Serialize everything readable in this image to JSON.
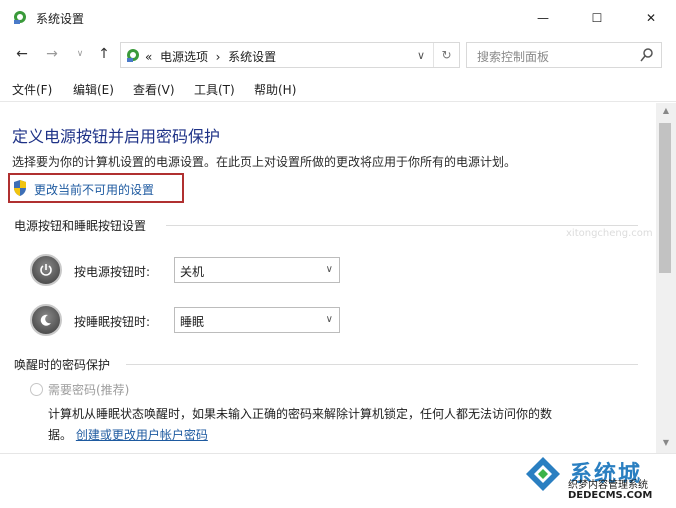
{
  "window": {
    "title": "系统设置",
    "controls": {
      "minimize": "—",
      "maximize": "☐",
      "close": "✕"
    }
  },
  "nav": {
    "back": "←",
    "forward": "→",
    "dropdown": "∨",
    "up": "↑",
    "breadcrumb_chevron": "«",
    "crumbs": [
      "电源选项",
      "系统设置"
    ],
    "crumb_sep": "›",
    "address_dropdown": "∨",
    "refresh": "↻"
  },
  "search": {
    "placeholder": "搜索控制面板"
  },
  "menu": [
    "文件(F)",
    "编辑(E)",
    "查看(V)",
    "工具(T)",
    "帮助(H)"
  ],
  "main": {
    "heading": "定义电源按钮并启用密码保护",
    "description": "选择要为你的计算机设置的电源设置。在此页上对设置所做的更改将应用于你所有的电源计划。",
    "change_link": "更改当前不可用的设置",
    "section_buttons": "电源按钮和睡眠按钮设置",
    "power_button": {
      "label": "按电源按钮时:",
      "value": "关机"
    },
    "sleep_button": {
      "label": "按睡眠按钮时:",
      "value": "睡眠"
    },
    "section_password": "唤醒时的密码保护",
    "require_password": {
      "label": "需要密码(推荐)",
      "selected": false
    },
    "help_line1": "计算机从睡眠状态唤醒时，如果未输入正确的密码来解除计算机锁定，任何人都无法访问你的数",
    "help_line2_prefix": "据。",
    "help_link": "创建或更改用户帐户密码"
  },
  "watermark": {
    "brand": "系统城",
    "site_name": "织梦内容管理系统",
    "url": "DEDECMS.COM",
    "faint": "xitongcheng.com"
  },
  "colors": {
    "heading": "#1e3287",
    "link": "#1e5aa0",
    "highlight_box": "#b03030"
  }
}
